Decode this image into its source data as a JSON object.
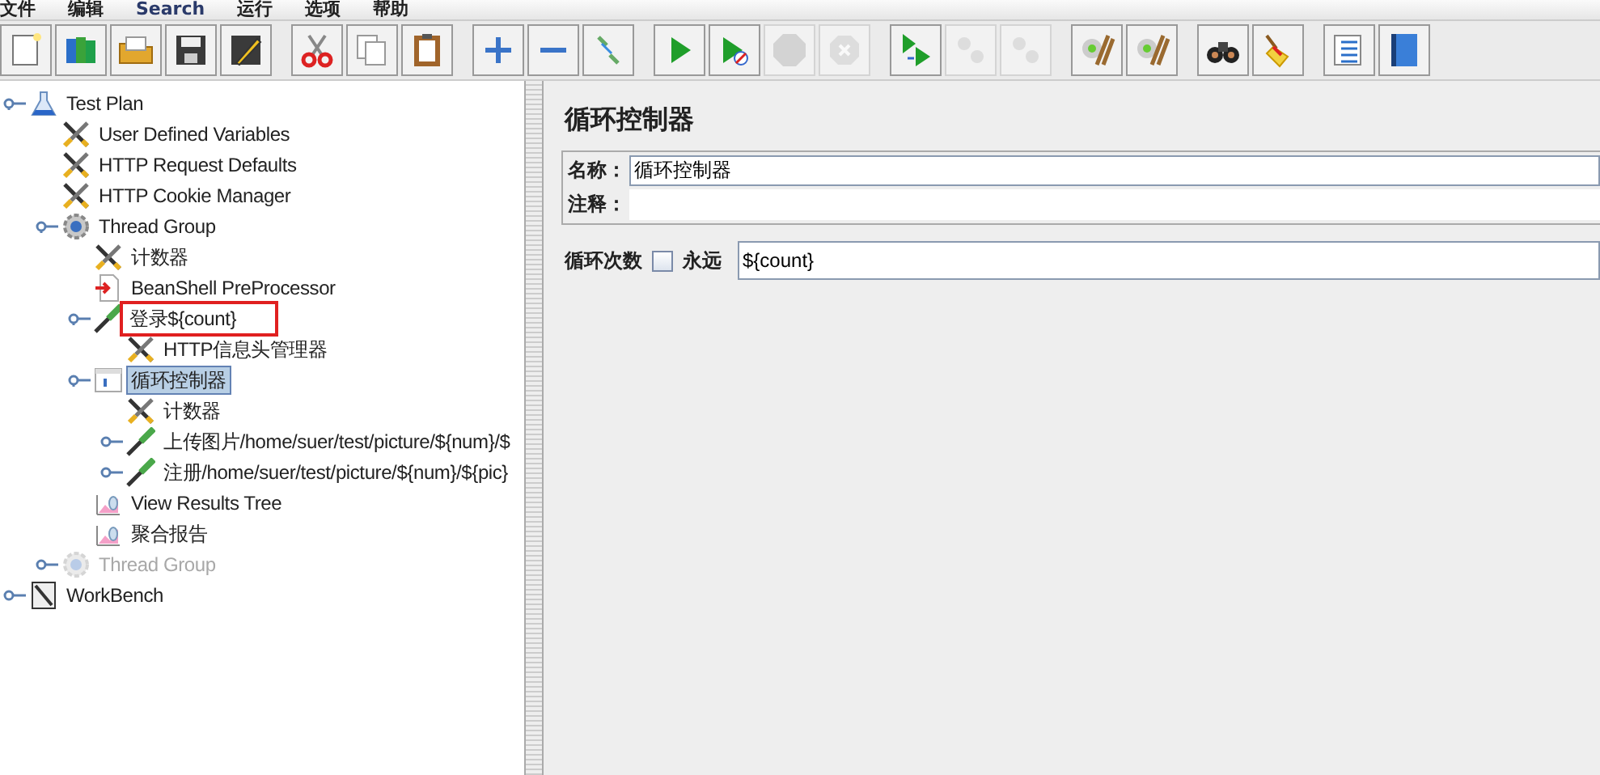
{
  "menu": [
    "文件",
    "编辑",
    "Search",
    "运行",
    "选项",
    "帮助"
  ],
  "toolbar": [
    {
      "kind": "new",
      "disabled": false
    },
    {
      "kind": "templates",
      "disabled": false
    },
    {
      "kind": "open",
      "disabled": false
    },
    {
      "kind": "save",
      "disabled": false
    },
    {
      "kind": "save-as",
      "disabled": false
    },
    {
      "kind": "sep"
    },
    {
      "kind": "cut",
      "disabled": false
    },
    {
      "kind": "copy",
      "disabled": false
    },
    {
      "kind": "paste",
      "disabled": false
    },
    {
      "kind": "sep"
    },
    {
      "kind": "expand",
      "disabled": false
    },
    {
      "kind": "collapse",
      "disabled": false
    },
    {
      "kind": "toggle",
      "disabled": false
    },
    {
      "kind": "sep"
    },
    {
      "kind": "start",
      "disabled": false
    },
    {
      "kind": "start-no-pause",
      "disabled": false
    },
    {
      "kind": "stop",
      "disabled": true
    },
    {
      "kind": "shutdown",
      "disabled": true
    },
    {
      "kind": "sep"
    },
    {
      "kind": "remote-start",
      "disabled": false
    },
    {
      "kind": "remote-stop",
      "disabled": true
    },
    {
      "kind": "remote-exit",
      "disabled": true
    },
    {
      "kind": "sep"
    },
    {
      "kind": "clear",
      "disabled": false
    },
    {
      "kind": "clear-all",
      "disabled": false
    },
    {
      "kind": "sep"
    },
    {
      "kind": "search",
      "disabled": false
    },
    {
      "kind": "reset",
      "disabled": false
    },
    {
      "kind": "sep"
    },
    {
      "kind": "list",
      "disabled": false
    },
    {
      "kind": "help",
      "disabled": false
    }
  ],
  "tree": [
    {
      "label": "Test Plan",
      "kind": "plan",
      "expanded": true,
      "selected": false,
      "disabled": false,
      "highlighted": false,
      "children": [
        {
          "label": "User Defined Variables",
          "kind": "config",
          "selected": false,
          "disabled": false,
          "highlighted": false
        },
        {
          "label": "HTTP Request Defaults",
          "kind": "config",
          "selected": false,
          "disabled": false,
          "highlighted": false
        },
        {
          "label": "HTTP Cookie Manager",
          "kind": "config",
          "selected": false,
          "disabled": false,
          "highlighted": false
        },
        {
          "label": "Thread Group",
          "kind": "threads",
          "expanded": true,
          "selected": false,
          "disabled": false,
          "highlighted": false,
          "children": [
            {
              "label": "计数器",
              "kind": "config",
              "selected": false,
              "disabled": false,
              "highlighted": false
            },
            {
              "label": "BeanShell PreProcessor",
              "kind": "preprocessor",
              "selected": false,
              "disabled": false,
              "highlighted": false
            },
            {
              "label": "登录${count}",
              "kind": "sampler",
              "expanded": true,
              "selected": false,
              "disabled": false,
              "highlighted": true,
              "children": [
                {
                  "label": "HTTP信息头管理器",
                  "kind": "config",
                  "selected": false,
                  "disabled": false,
                  "highlighted": false
                }
              ]
            },
            {
              "label": "循环控制器",
              "kind": "controller",
              "expanded": true,
              "selected": true,
              "disabled": false,
              "highlighted": false,
              "children": [
                {
                  "label": "计数器",
                  "kind": "config",
                  "selected": false,
                  "disabled": false,
                  "highlighted": false
                },
                {
                  "label": "上传图片/home/suer/test/picture/${num}/$",
                  "kind": "sampler",
                  "expanded": false,
                  "selected": false,
                  "disabled": false,
                  "highlighted": false
                },
                {
                  "label": "注册/home/suer/test/picture/${num}/${pic}",
                  "kind": "sampler",
                  "expanded": false,
                  "selected": false,
                  "disabled": false,
                  "highlighted": false
                }
              ]
            },
            {
              "label": "View Results Tree",
              "kind": "listener",
              "selected": false,
              "disabled": false,
              "highlighted": false
            },
            {
              "label": "聚合报告",
              "kind": "listener",
              "selected": false,
              "disabled": false,
              "highlighted": false
            }
          ]
        },
        {
          "label": "Thread Group",
          "kind": "threads",
          "expanded": false,
          "selected": false,
          "disabled": true,
          "highlighted": false
        }
      ]
    },
    {
      "label": "WorkBench",
      "kind": "workbench",
      "expanded": false,
      "selected": false,
      "disabled": false,
      "highlighted": false
    }
  ],
  "panel": {
    "title": "循环控制器",
    "name_label": "名称：",
    "name_value": "循环控制器",
    "comments_label": "注释：",
    "loop_label": "循环次数",
    "forever_label": "永远",
    "forever_checked": false,
    "loop_value": "${count}"
  }
}
